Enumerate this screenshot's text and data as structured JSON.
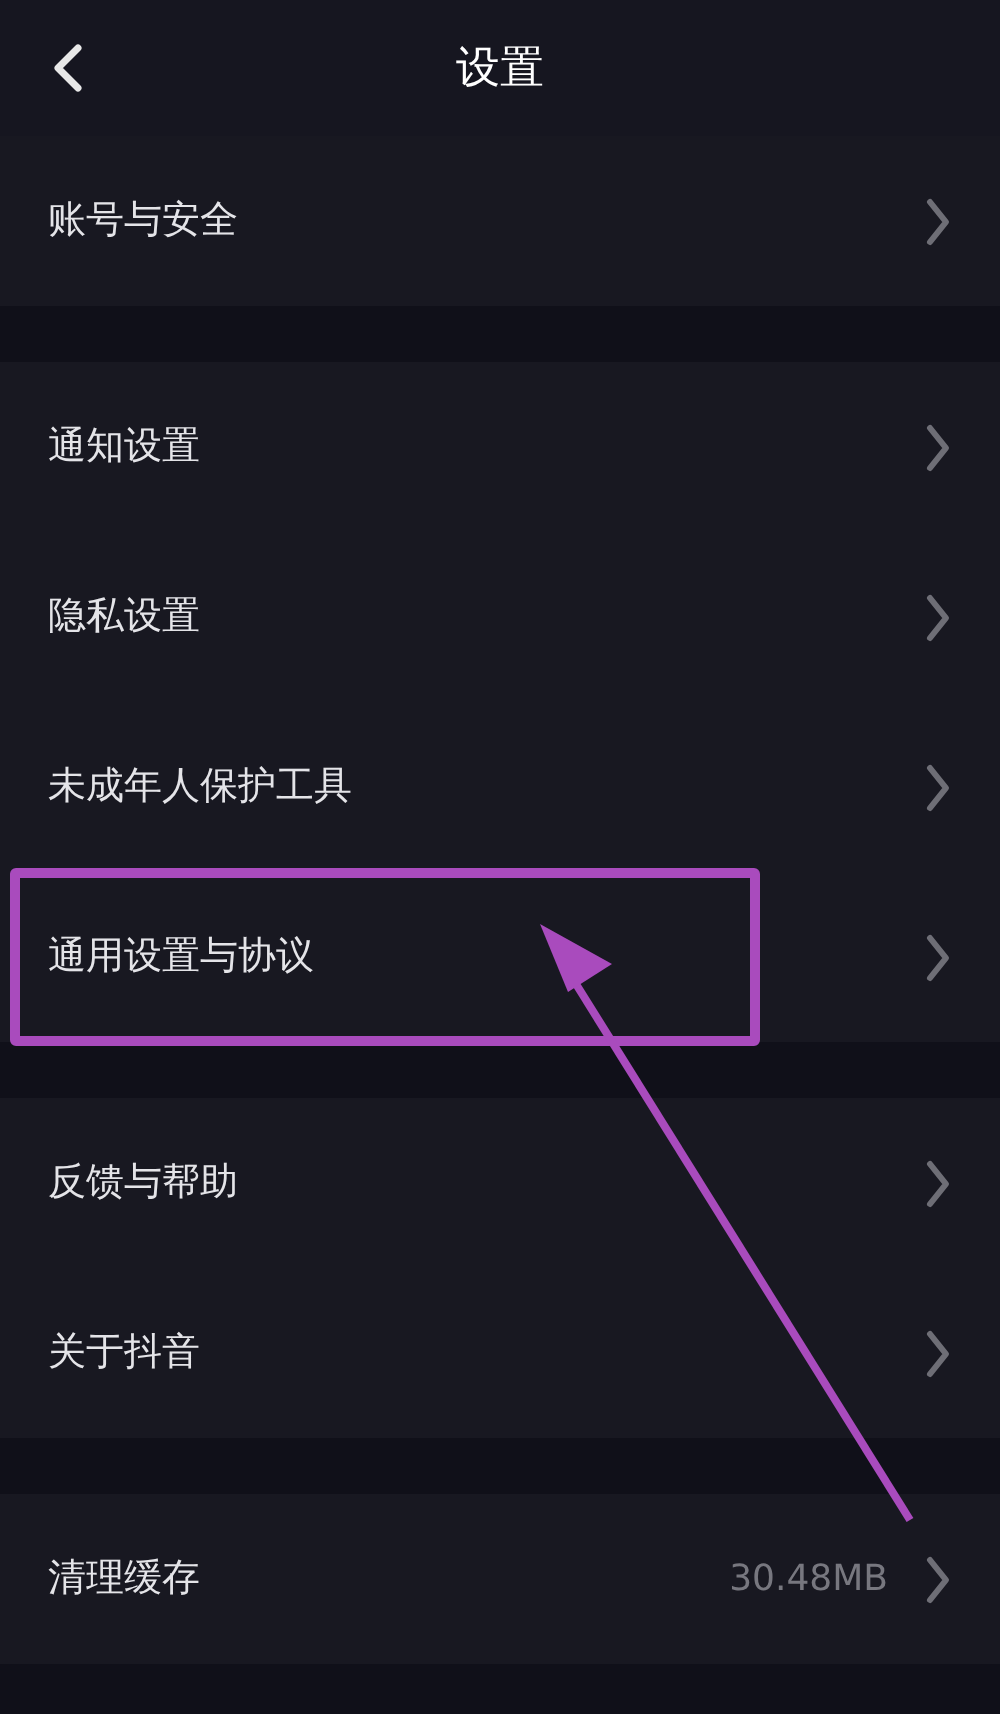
{
  "header": {
    "title": "设置"
  },
  "sections": [
    {
      "rows": [
        {
          "label": "账号与安全"
        }
      ]
    },
    {
      "rows": [
        {
          "label": "通知设置"
        },
        {
          "label": "隐私设置"
        },
        {
          "label": "未成年人保护工具"
        },
        {
          "label": "通用设置与协议"
        }
      ]
    },
    {
      "rows": [
        {
          "label": "反馈与帮助"
        },
        {
          "label": "关于抖音"
        }
      ]
    },
    {
      "rows": [
        {
          "label": "清理缓存",
          "value": "30.48MB"
        }
      ]
    }
  ]
}
